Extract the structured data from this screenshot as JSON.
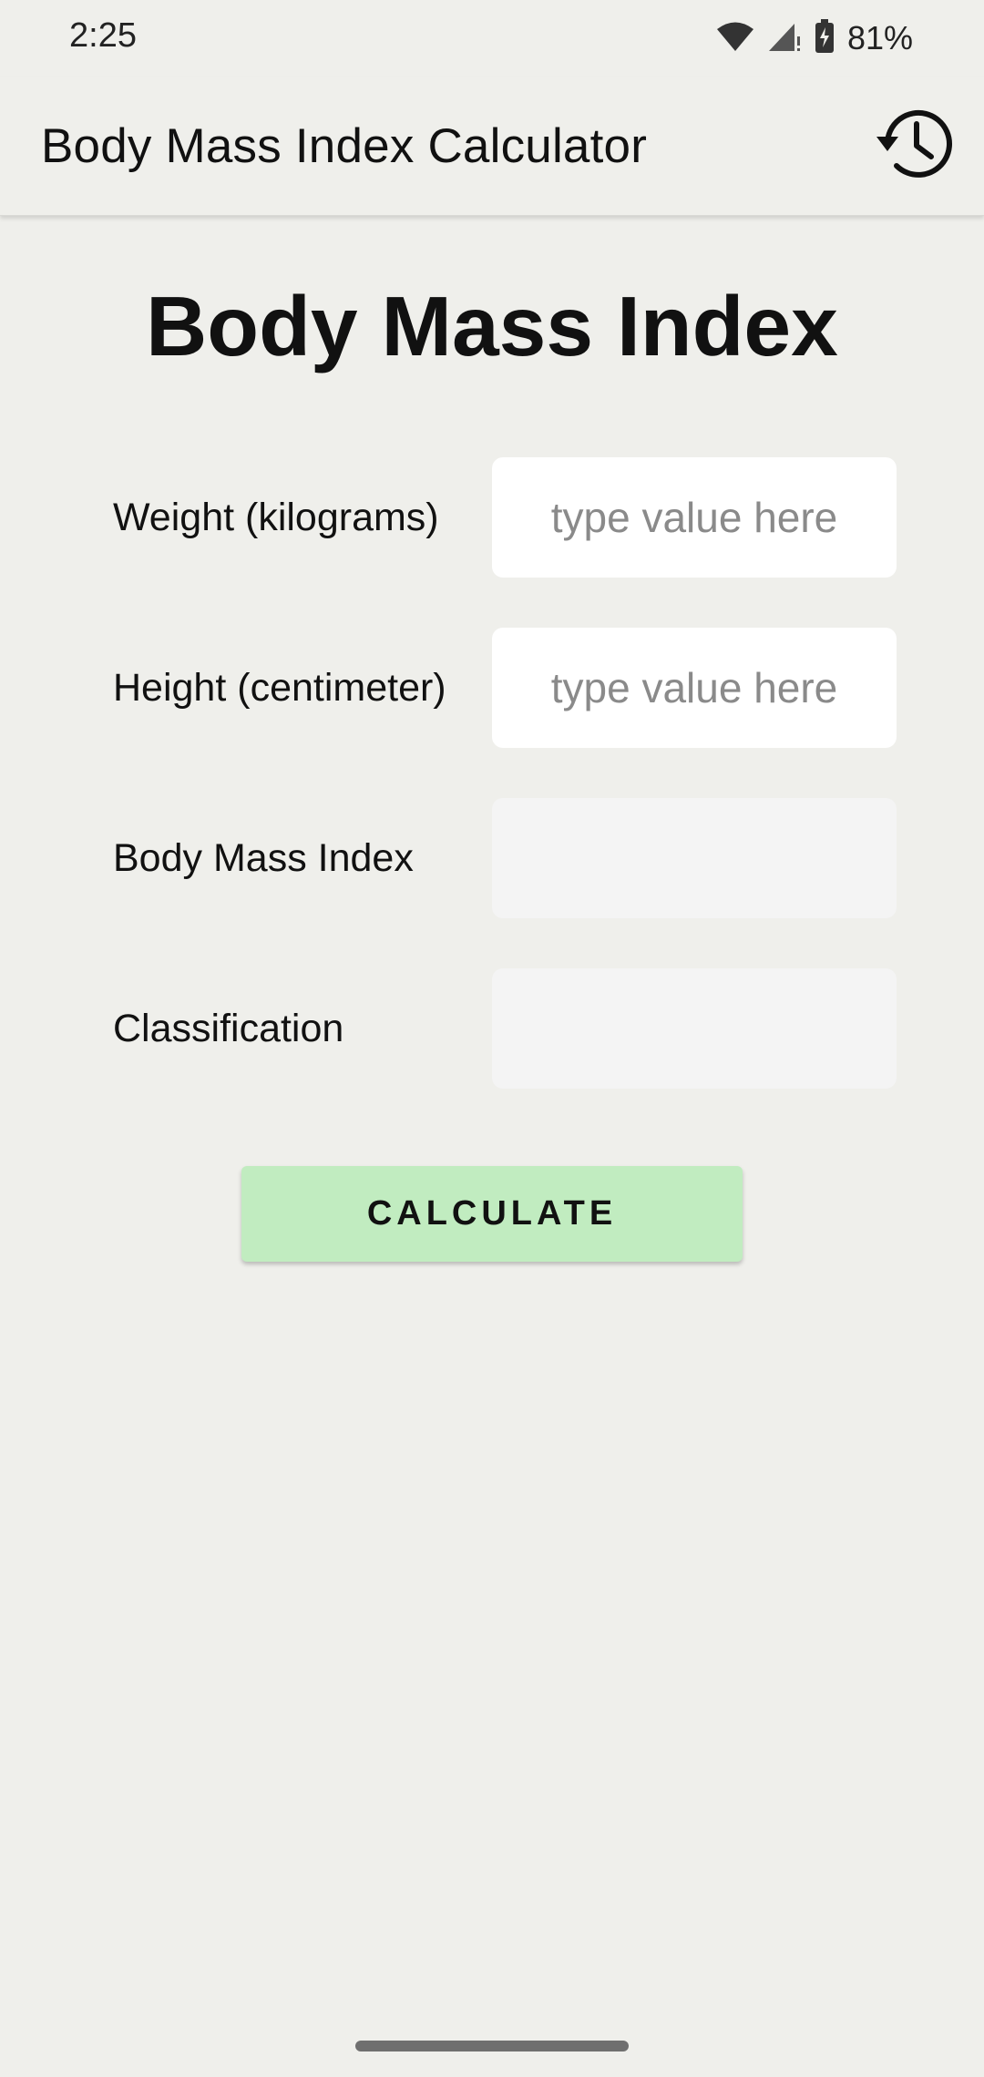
{
  "status_bar": {
    "time": "2:25",
    "battery_percent": "81%",
    "icons": [
      "wifi-icon",
      "signal-icon",
      "battery-charging-icon"
    ]
  },
  "app_bar": {
    "title": "Body Mass Index Calculator",
    "history_icon": "history-icon"
  },
  "main": {
    "heading": "Body Mass Index",
    "fields": {
      "weight": {
        "label": "Weight (kilograms)",
        "placeholder": "type value here",
        "value": ""
      },
      "height": {
        "label": "Height (centimeter)",
        "placeholder": "type value here",
        "value": ""
      },
      "bmi": {
        "label": "Body Mass Index",
        "value": ""
      },
      "classification": {
        "label": "Classification",
        "value": ""
      }
    },
    "calculate_label": "CALCULATE"
  },
  "colors": {
    "background": "#efefeb",
    "button": "#c1ecc0",
    "input_background": "#ffffff",
    "readonly_background": "#f4f4f4"
  }
}
